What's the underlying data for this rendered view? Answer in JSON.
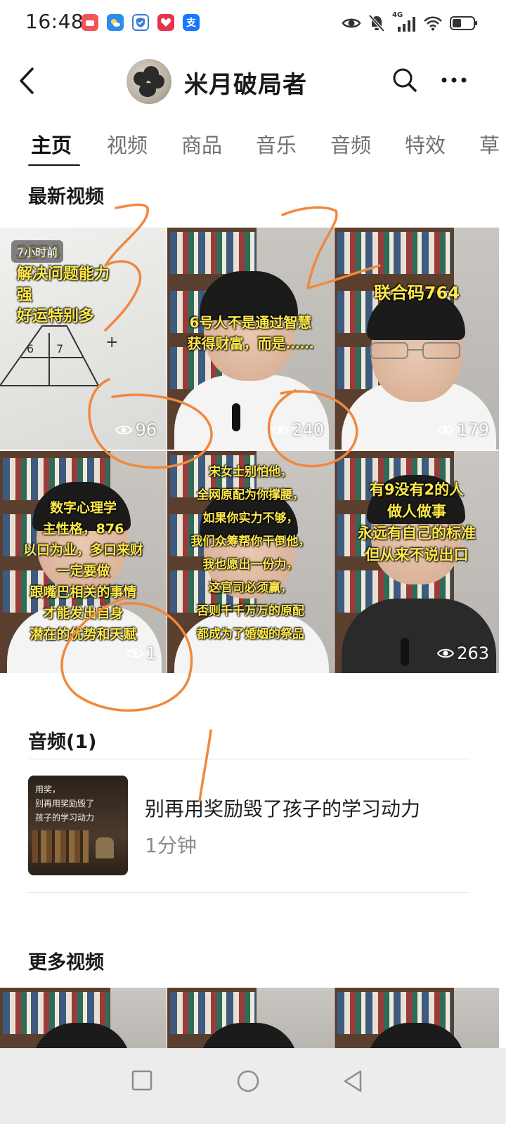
{
  "status_bar": {
    "time": "16:48",
    "network": "4G",
    "notification_icons": [
      {
        "name": "red-app-icon",
        "color": "#f2545b"
      },
      {
        "name": "weather-app-icon",
        "color": "#2d8cf0"
      },
      {
        "name": "shield-app-icon",
        "color": "#3a7bd5"
      },
      {
        "name": "heart-app-icon",
        "color": "#e8334a"
      },
      {
        "name": "alipay-app-icon",
        "color": "#1677ff",
        "glyph": "支"
      }
    ],
    "system_icons": [
      "eye-icon",
      "mute-icon",
      "signal-icon",
      "wifi-icon",
      "battery-icon"
    ]
  },
  "header": {
    "channel_name": "米月破局者",
    "icons": [
      "back-arrow-icon",
      "search-icon",
      "more-icon"
    ]
  },
  "tabs": [
    {
      "label": "主页",
      "active": true
    },
    {
      "label": "视频",
      "active": false
    },
    {
      "label": "商品",
      "active": false
    },
    {
      "label": "音乐",
      "active": false
    },
    {
      "label": "音频",
      "active": false
    },
    {
      "label": "特效",
      "active": false
    },
    {
      "label": "草",
      "active": false
    }
  ],
  "latest_videos": {
    "title": "最新视频",
    "items": [
      {
        "badge": "7小时前",
        "caption": "3674\n解决问题能力\n强\n好运特别多",
        "views": "96",
        "style": "whiteboard"
      },
      {
        "caption": "6号人不是通过智慧\n获得财富，而是……",
        "views": "240",
        "style": "person"
      },
      {
        "caption": "联合码764",
        "views": "179",
        "style": "person-glasses"
      },
      {
        "caption": "数字心理学\n主性格，876\n以口为业，多口来财\n一定要做\n跟嘴巴相关的事情\n才能发出自身\n潜在的优势和天赋",
        "views": "1",
        "style": "person"
      },
      {
        "caption": "宋女士别怕他，\n全网原配为你撑腰，\n如果你实力不够，\n我们众筹帮你干倒他，\n我也愿出一份力，\n这官司必须赢，\n否则千千万万的原配\n都成为了婚姻的祭品",
        "views": "",
        "style": "person"
      },
      {
        "caption": "有9没有2的人\n做人做事\n永远有自己的标准\n但从来不说出口",
        "views": "263",
        "style": "person-dark"
      }
    ]
  },
  "audio": {
    "title": "音频(1)",
    "items": [
      {
        "thumb_text": "用奖，\n别再用奖励毁了\n孩子的学习动力",
        "title": "别再用奖励毁了孩子的学习动力",
        "duration": "1分钟"
      }
    ]
  },
  "more_videos": {
    "title": "更多视频"
  },
  "colors": {
    "annotation": "#f0883e",
    "overlay_text": "#ffe94a",
    "nav_bar_bg": "#ececec"
  }
}
